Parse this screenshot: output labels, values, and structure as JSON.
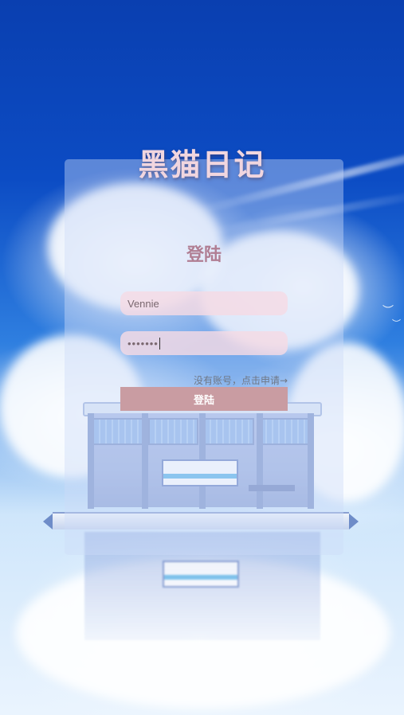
{
  "app": {
    "title": "黑猫日记"
  },
  "login": {
    "heading": "登陆",
    "username_value": "Vennie",
    "password_value": "•••••••",
    "register_link": "没有账号，点击申请→",
    "submit_label": "登陆"
  },
  "colors": {
    "title": "#f1d6df",
    "heading": "#b07e93",
    "input_bg": "#f5dae4",
    "button_bg": "#c99ca2",
    "panel_bg": "#cddcf8"
  }
}
